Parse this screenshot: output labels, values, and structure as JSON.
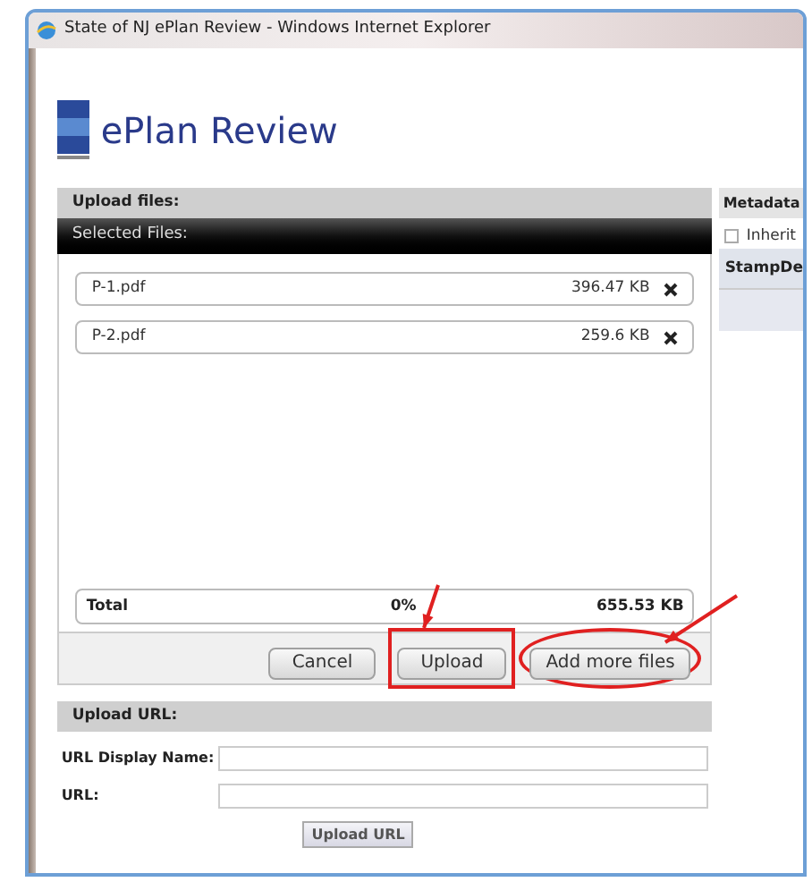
{
  "window": {
    "title": "State of NJ ePlan Review - Windows Internet Explorer"
  },
  "app": {
    "title": "ePlan Review"
  },
  "upload_files": {
    "header": "Upload files:",
    "list_header": "Selected Files:",
    "files": [
      {
        "name": "P-1.pdf",
        "size": "396.47 KB"
      },
      {
        "name": "P-2.pdf",
        "size": "259.6 KB"
      }
    ],
    "total": {
      "label": "Total",
      "progress": "0%",
      "level": 0,
      "size": "655.53 KB"
    },
    "buttons": [
      {
        "label": "Cancel",
        "kind": "plain"
      },
      {
        "label": "Upload",
        "kind": "boxed"
      },
      {
        "label": "Add more files",
        "kind": "circled"
      }
    ]
  },
  "metadata": {
    "header": "Metadata",
    "checkbox": {
      "label": "Inherit",
      "checked": false
    },
    "column": "StampDe"
  },
  "upload_url": {
    "header": "Upload URL:",
    "fields": [
      {
        "label": "URL Display Name:"
      },
      {
        "label": "URL:"
      }
    ],
    "button": "Upload URL"
  }
}
